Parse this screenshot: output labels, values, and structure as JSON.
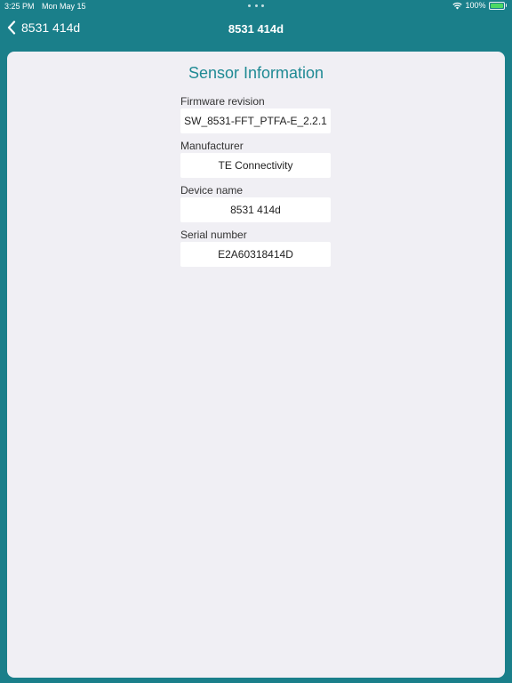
{
  "status_bar": {
    "time": "3:25 PM",
    "date": "Mon May 15",
    "battery": "100%",
    "battery_level": 1.0
  },
  "nav": {
    "back_label": "8531 414d",
    "title": "8531 414d"
  },
  "sensor_info": {
    "title": "Sensor Information",
    "fields": [
      {
        "label": "Firmware revision",
        "value": "SW_8531-FFT_PTFA-E_2.2.1"
      },
      {
        "label": "Manufacturer",
        "value": "TE Connectivity"
      },
      {
        "label": "Device name",
        "value": "8531 414d"
      },
      {
        "label": "Serial number",
        "value": "E2A60318414D"
      }
    ]
  },
  "colors": {
    "background": "#1a7f8a",
    "accent": "#1f8a94",
    "sheet": "#f0eff4"
  }
}
